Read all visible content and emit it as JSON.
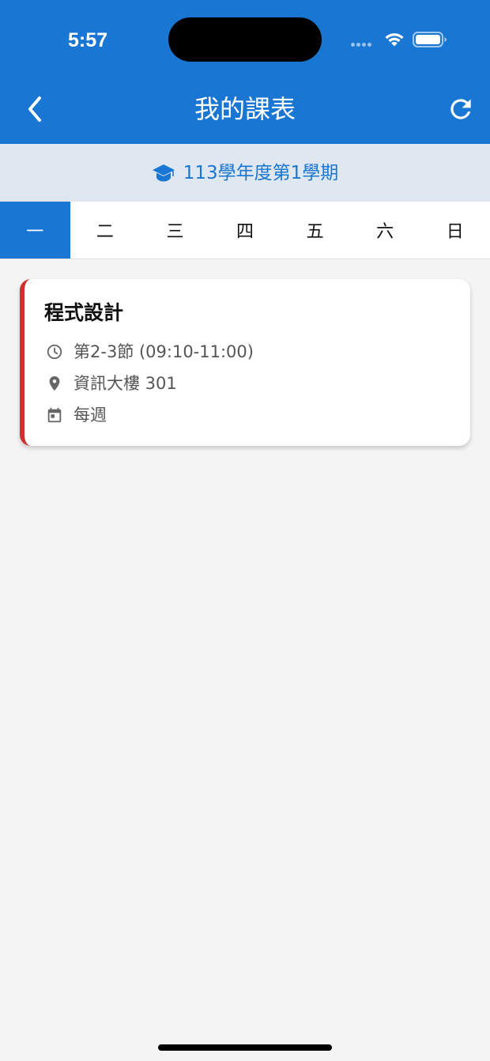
{
  "status_bar": {
    "time": "5:57"
  },
  "header": {
    "title": "我的課表",
    "back_icon": "chevron-left-icon",
    "refresh_icon": "refresh-icon",
    "background": "#1976d2"
  },
  "semester": {
    "icon": "graduation-cap-icon",
    "label": "113學年度第1學期"
  },
  "weekdays": {
    "tabs": [
      "一",
      "二",
      "三",
      "四",
      "五",
      "六",
      "日"
    ],
    "selected": "一"
  },
  "courses": [
    {
      "name": "程式設計",
      "time": "第2-3節 (09:10-11:00)",
      "location": "資訊大樓 301",
      "frequency": "每週",
      "accent_color": "#d32f2f"
    }
  ]
}
